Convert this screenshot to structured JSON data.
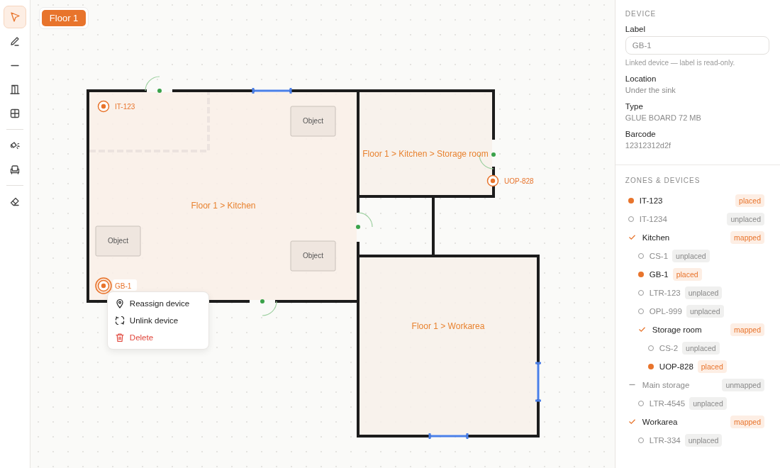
{
  "toolbar": {
    "tools": [
      {
        "selected": true
      },
      {
        "selected": false
      },
      {
        "selected": false
      },
      {
        "selected": false
      },
      {
        "selected": false
      },
      {
        "selected": false
      },
      {
        "selected": false
      },
      {
        "selected": false
      }
    ]
  },
  "floor_button": {
    "label": "Floor 1"
  },
  "canvas": {
    "rooms": [
      {
        "label": "Floor 1 > Kitchen"
      },
      {
        "label": "Floor 1 > Kitchen > Storage room"
      },
      {
        "label": "Floor 1 > Workarea"
      }
    ],
    "objects": [
      {
        "label": "Object"
      },
      {
        "label": "Object"
      },
      {
        "label": "Object"
      }
    ],
    "devices": [
      {
        "label": "IT-123",
        "selected": false
      },
      {
        "label": "GB-1",
        "selected": true
      },
      {
        "label": "UOP-828",
        "selected": false
      }
    ]
  },
  "context_menu": [
    {
      "label": "Reassign device",
      "kind": "action"
    },
    {
      "label": "Unlink device",
      "kind": "action"
    },
    {
      "label": "Delete",
      "kind": "danger"
    }
  ],
  "panel": {
    "section": "DEVICE",
    "label_field": {
      "label": "Label",
      "value": "GB-1",
      "hint": "Linked device — label is read-only."
    },
    "fields": [
      {
        "label": "Location",
        "value": "Under the sink"
      },
      {
        "label": "Type",
        "value": "GLUE BOARD 72 MB"
      },
      {
        "label": "Barcode",
        "value": "12312312d2f"
      }
    ],
    "tree_title": "ZONES & DEVICES",
    "tree": [
      {
        "kind": "device",
        "name": "IT-123",
        "status": "placed",
        "placed": true
      },
      {
        "kind": "device",
        "name": "IT-1234",
        "status": "unplaced",
        "placed": false
      },
      {
        "kind": "zone",
        "name": "Kitchen",
        "status": "mapped",
        "mapped": true,
        "children": [
          {
            "kind": "device",
            "name": "CS-1",
            "status": "unplaced",
            "placed": false
          },
          {
            "kind": "device",
            "name": "GB-1",
            "status": "placed",
            "placed": true
          },
          {
            "kind": "device",
            "name": "LTR-123",
            "status": "unplaced",
            "placed": false
          },
          {
            "kind": "device",
            "name": "OPL-999",
            "status": "unplaced",
            "placed": false
          },
          {
            "kind": "zone",
            "name": "Storage room",
            "status": "mapped",
            "mapped": true,
            "children": [
              {
                "kind": "device",
                "name": "CS-2",
                "status": "unplaced",
                "placed": false
              },
              {
                "kind": "device",
                "name": "UOP-828",
                "status": "placed",
                "placed": true
              }
            ]
          }
        ]
      },
      {
        "kind": "zone",
        "name": "Main storage",
        "status": "unmapped",
        "mapped": false,
        "children": [
          {
            "kind": "device",
            "name": "LTR-4545",
            "status": "unplaced",
            "placed": false
          }
        ]
      },
      {
        "kind": "zone",
        "name": "Workarea",
        "status": "mapped",
        "mapped": true,
        "children": [
          {
            "kind": "device",
            "name": "LTR-334",
            "status": "unplaced",
            "placed": false
          }
        ]
      }
    ]
  }
}
